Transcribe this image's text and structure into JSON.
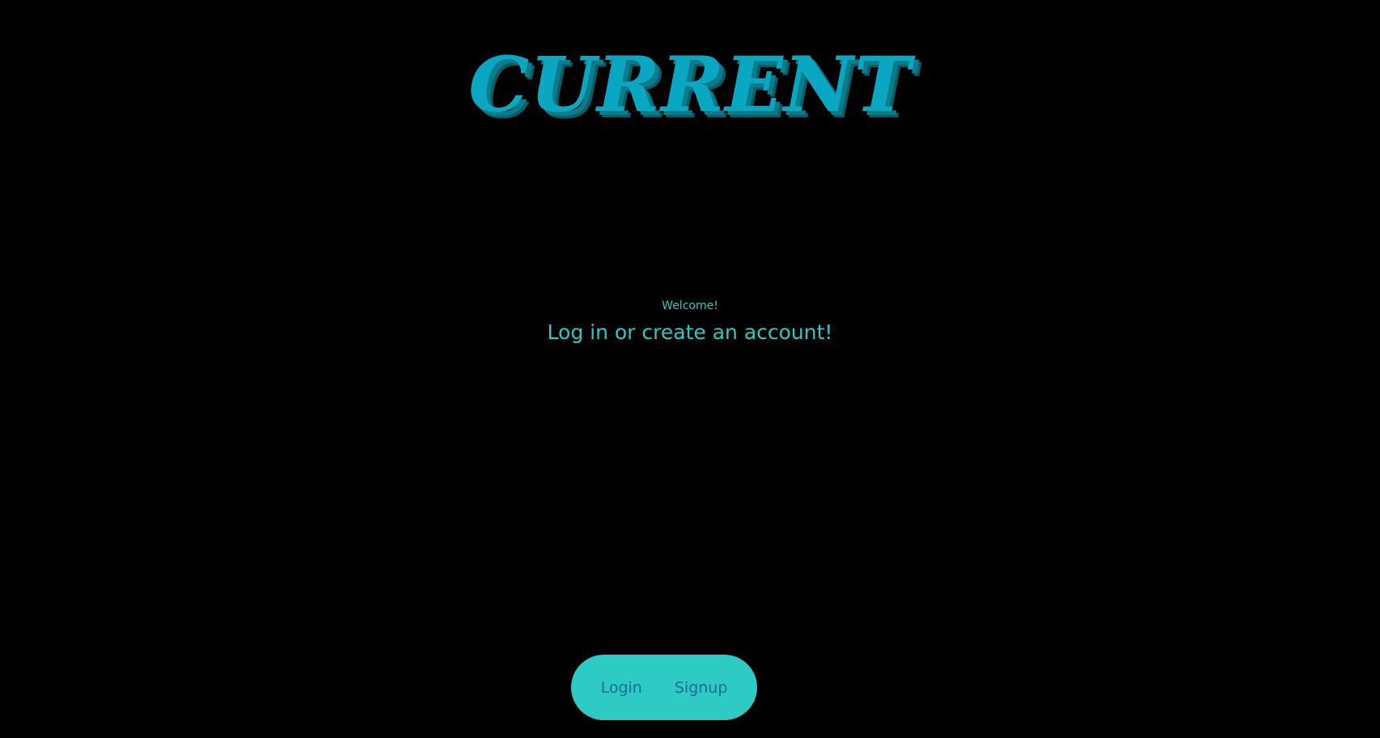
{
  "app": {
    "logo_text": "CURRENT"
  },
  "welcome": {
    "greeting": "Welcome!",
    "prompt": "Log in or create an account!"
  },
  "auth": {
    "login_label": "Login",
    "signup_label": "Signup"
  },
  "colors": {
    "background": "#000000",
    "logo": "#0aa7c3",
    "logo_shadow": "#0a7c8a",
    "accent_text": "#2ec9c2",
    "pill_background": "#2ecbc4",
    "pill_text": "#1b6a9a"
  }
}
